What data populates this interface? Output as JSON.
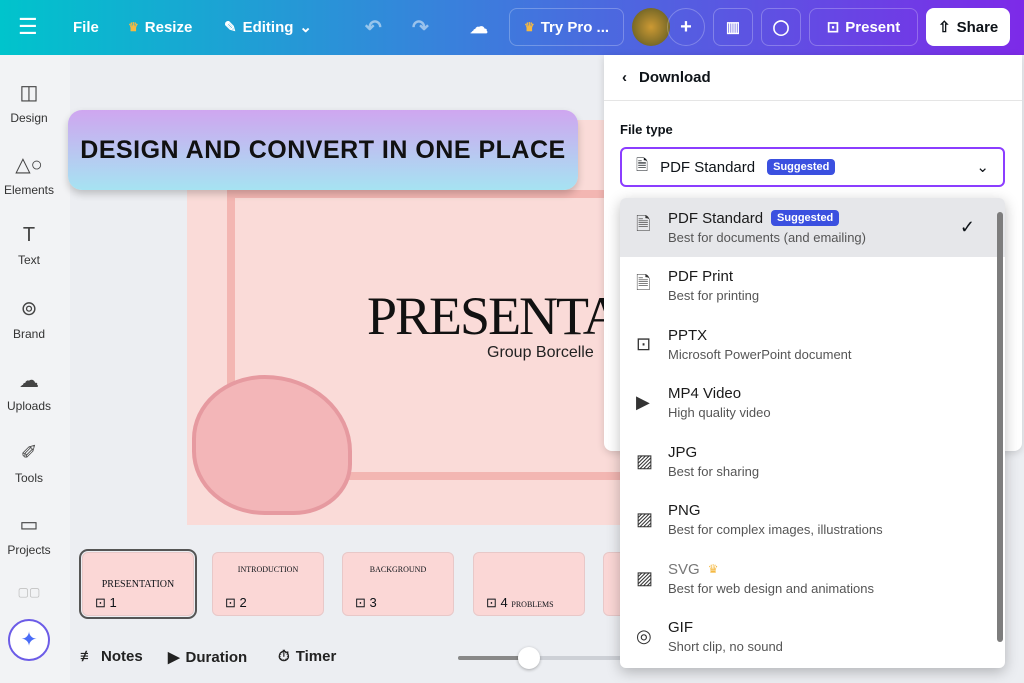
{
  "topbar": {
    "file": "File",
    "resize": "Resize",
    "editing": "Editing",
    "try_pro": "Try Pro ...",
    "present": "Present",
    "share": "Share"
  },
  "sidebar": [
    {
      "label": "Design",
      "icon": "layout-icon"
    },
    {
      "label": "Elements",
      "icon": "shapes-icon"
    },
    {
      "label": "Text",
      "icon": "text-icon"
    },
    {
      "label": "Brand",
      "icon": "brand-icon"
    },
    {
      "label": "Uploads",
      "icon": "upload-icon"
    },
    {
      "label": "Tools",
      "icon": "pen-icon"
    },
    {
      "label": "Projects",
      "icon": "folder-icon"
    }
  ],
  "banner": "DESIGN AND CONVERT IN ONE PLACE",
  "slide": {
    "title": "PRESENTA",
    "subtitle": "Group Borcelle"
  },
  "thumbnails": [
    {
      "n": "1",
      "title": "PRESENTATION"
    },
    {
      "n": "2",
      "title": "INTRODUCTION"
    },
    {
      "n": "3",
      "title": "BACKGROUND"
    },
    {
      "n": "4",
      "title": "PROBLEMS"
    }
  ],
  "bottom": {
    "notes": "Notes",
    "duration": "Duration",
    "timer": "Timer",
    "zoom_fraction": 0.42
  },
  "download": {
    "title": "Download",
    "file_type_label": "File type",
    "selected": "PDF Standard",
    "selected_badge": "Suggested",
    "options": [
      {
        "name": "PDF Standard",
        "badge": "Suggested",
        "desc": "Best for documents (and emailing)"
      },
      {
        "name": "PDF Print",
        "desc": "Best for printing"
      },
      {
        "name": "PPTX",
        "desc": "Microsoft PowerPoint document"
      },
      {
        "name": "MP4 Video",
        "desc": "High quality video"
      },
      {
        "name": "JPG",
        "desc": "Best for sharing"
      },
      {
        "name": "PNG",
        "desc": "Best for complex images, illustrations"
      },
      {
        "name": "SVG",
        "desc": "Best for web design and animations"
      },
      {
        "name": "GIF",
        "desc": "Short clip, no sound"
      }
    ]
  }
}
